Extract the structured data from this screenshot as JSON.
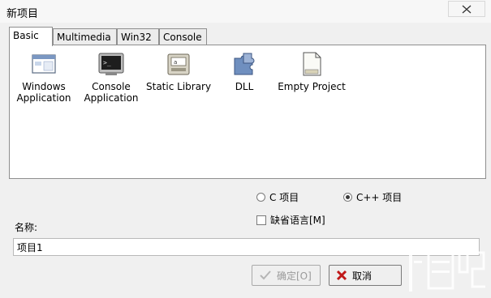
{
  "window": {
    "title": "新项目"
  },
  "tabs": [
    {
      "label": "Basic"
    },
    {
      "label": "Multimedia"
    },
    {
      "label": "Win32"
    },
    {
      "label": "Console"
    }
  ],
  "projects": [
    {
      "label": "Windows\nApplication",
      "icon": "window-app-icon"
    },
    {
      "label": "Console\nApplication",
      "icon": "console-app-icon"
    },
    {
      "label": "Static Library",
      "icon": "static-library-icon"
    },
    {
      "label": "DLL",
      "icon": "dll-puzzle-icon"
    },
    {
      "label": "Empty Project",
      "icon": "empty-project-icon"
    }
  ],
  "language": {
    "c_label": "C 项目",
    "cpp_label": "C++ 项目",
    "selected": "C++"
  },
  "default_language": {
    "label": "缺省语言[M]",
    "checked": false
  },
  "name": {
    "label": "名称:",
    "value": "项目1"
  },
  "buttons": {
    "ok": "确定[O]",
    "cancel": "取消"
  },
  "watermark": {
    "text": "下载吧"
  }
}
